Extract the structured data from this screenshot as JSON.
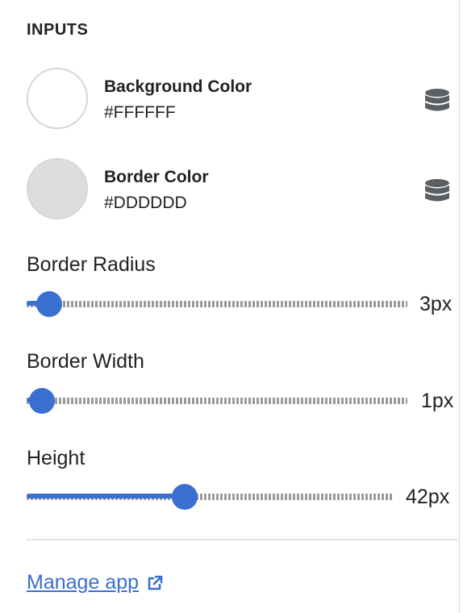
{
  "section": {
    "title": "INPUTS"
  },
  "colors": [
    {
      "label": "Background Color",
      "value": "#FFFFFF",
      "swatch": "#FFFFFF",
      "icon": "database-icon"
    },
    {
      "label": "Border Color",
      "value": "#DDDDDD",
      "swatch": "#DDDDDD",
      "icon": "database-icon"
    }
  ],
  "sliders": [
    {
      "label": "Border Radius",
      "value": "3px",
      "fraction": 0.06
    },
    {
      "label": "Border Width",
      "value": "1px",
      "fraction": 0.04
    },
    {
      "label": "Height",
      "value": "42px",
      "fraction": 0.43
    }
  ],
  "footer": {
    "link_label": "Manage app",
    "link_icon": "external-link-icon"
  },
  "theme": {
    "accent": "#3A6FD0",
    "text": "#202223"
  }
}
